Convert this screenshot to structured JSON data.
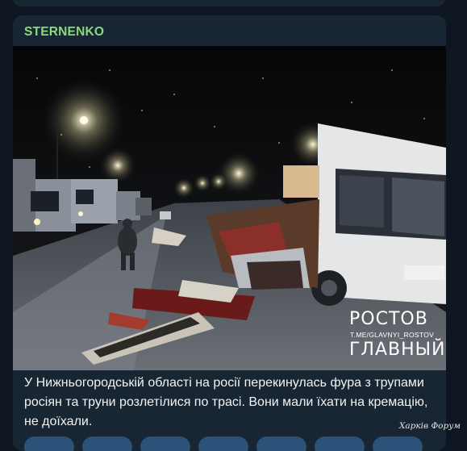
{
  "post": {
    "channel_name": "STERNENKO",
    "caption": "У Нижньогородській області на росії перекинулась фура з трупами росіян та труни розлетілися по трасі. Вони мали їхати на кремацію, не доїхали."
  },
  "photo": {
    "watermark_top": "РОСТОВ",
    "watermark_link": "T.ME/GLAVNYI_ROSTOV",
    "watermark_bottom": "ГЛАВНЫЙ"
  },
  "footer": {
    "forum_mark": "Харків Форум"
  },
  "colors": {
    "background": "#0e1621",
    "card": "#182533",
    "channel_name": "#8bd87d",
    "caption_text": "#f2f4f6"
  }
}
